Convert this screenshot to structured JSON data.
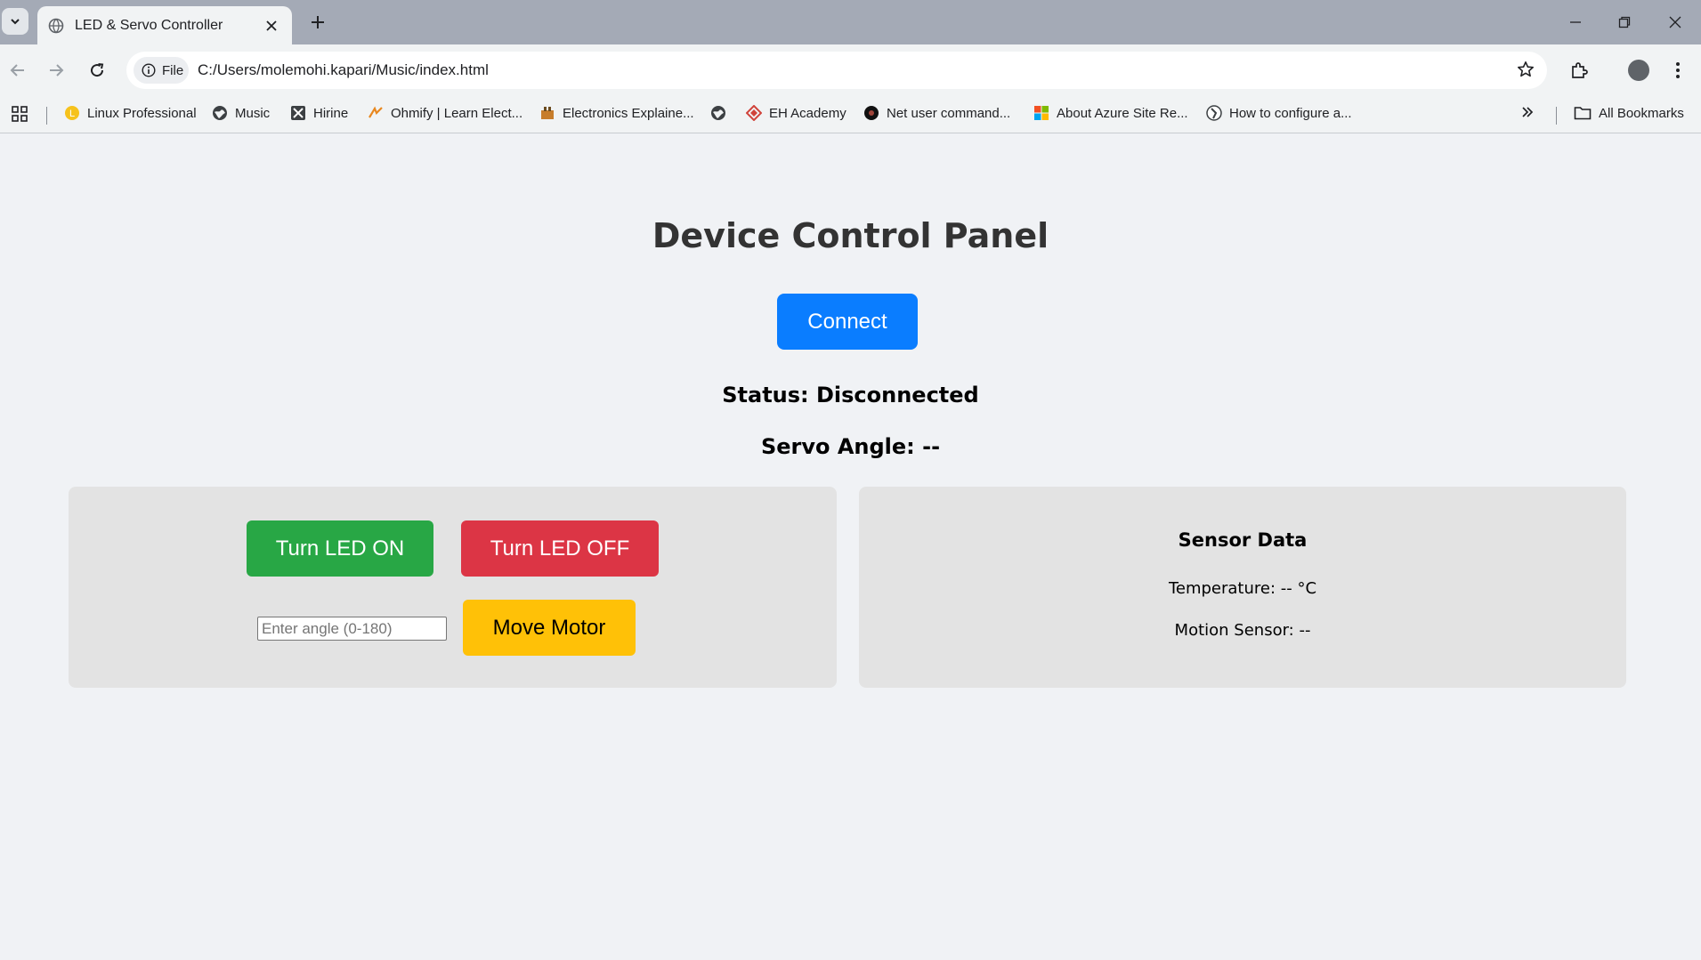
{
  "browser": {
    "tab_title": "LED & Servo Controller",
    "site_chip": "File",
    "url": "C:/Users/molemohi.kapari/Music/index.html",
    "bookmarks": [
      {
        "label": "Linux Professional",
        "icon": "lpi-icon"
      },
      {
        "label": "Music",
        "icon": "globe-icon"
      },
      {
        "label": "Hirine",
        "icon": "hirine-icon"
      },
      {
        "label": "Ohmify | Learn Elect...",
        "icon": "ohmify-icon"
      },
      {
        "label": "Electronics Explaine...",
        "icon": "electronics-icon"
      },
      {
        "label": "",
        "icon": "globe-icon"
      },
      {
        "label": "EH Academy",
        "icon": "eh-academy-icon"
      },
      {
        "label": "Net user command...",
        "icon": "net-user-icon"
      },
      {
        "label": "About Azure Site Re...",
        "icon": "microsoft-icon"
      },
      {
        "label": "How to configure a...",
        "icon": "howto-icon"
      }
    ],
    "all_bookmarks": "All Bookmarks"
  },
  "page": {
    "title": "Device Control Panel",
    "connect_label": "Connect",
    "status": "Status: Disconnected",
    "servo_angle": "Servo Angle: --",
    "controls": {
      "led_on_label": "Turn LED ON",
      "led_off_label": "Turn LED OFF",
      "angle_placeholder": "Enter angle (0-180)",
      "move_motor_label": "Move Motor"
    },
    "sensor": {
      "title": "Sensor Data",
      "temperature": "Temperature: -- °C",
      "motion": "Motion Sensor: --"
    }
  },
  "colors": {
    "connect": "#0a7dff",
    "led_on": "#28a745",
    "led_off": "#dc3545",
    "motor": "#ffc107"
  }
}
